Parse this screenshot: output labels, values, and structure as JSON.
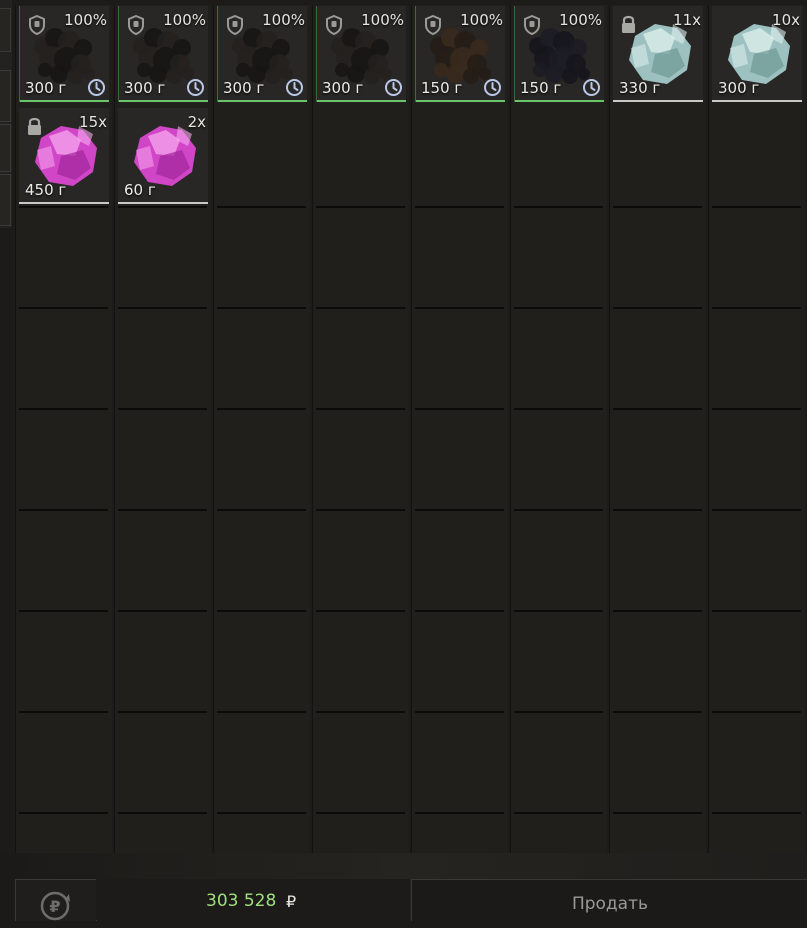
{
  "inventory": {
    "items": [
      {
        "type": "protected",
        "percent": "100%",
        "weight": "300 г",
        "art": "dark"
      },
      {
        "type": "protected",
        "percent": "100%",
        "weight": "300 г",
        "art": "dark"
      },
      {
        "type": "protected",
        "percent": "100%",
        "weight": "300 г",
        "art": "dark"
      },
      {
        "type": "protected",
        "percent": "100%",
        "weight": "300 г",
        "art": "dark"
      },
      {
        "type": "protected",
        "percent": "100%",
        "weight": "150 г",
        "art": "brown"
      },
      {
        "type": "protected",
        "percent": "100%",
        "weight": "150 г",
        "art": "navy"
      },
      {
        "type": "stack",
        "locked": true,
        "count": "11x",
        "weight": "330 г",
        "art": "ice"
      },
      {
        "type": "stack",
        "locked": false,
        "count": "10x",
        "weight": "300 г",
        "art": "ice"
      },
      {
        "type": "stack",
        "locked": true,
        "count": "15x",
        "weight": "450 г",
        "art": "pink"
      },
      {
        "type": "stack",
        "locked": false,
        "count": "2x",
        "weight": "60 г",
        "art": "pink"
      }
    ]
  },
  "footer": {
    "balance": "303 528",
    "currency": "₽",
    "sell_label": "Продать"
  },
  "colors": {
    "accent_green": "#69c46a",
    "stack_white": "#c8c8c4",
    "balance_green": "#9fe07e",
    "crystal_ice": "#a9d3d1",
    "crystal_pink": "#e34ad8"
  }
}
